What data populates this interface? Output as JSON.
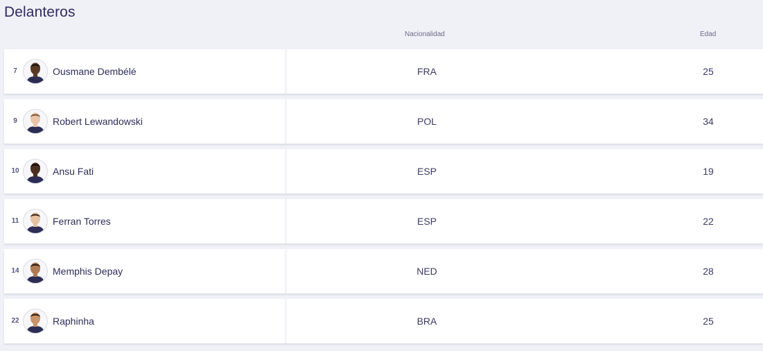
{
  "section": {
    "title": "Delanteros",
    "headers": {
      "nationality": "Nacionalidad",
      "age": "Edad"
    }
  },
  "players": [
    {
      "number": "7",
      "name": "Ousmane Dembélé",
      "nationality": "FRA",
      "age": "25",
      "skin": "#5a3a26",
      "hair": "#1b120c"
    },
    {
      "number": "9",
      "name": "Robert Lewandowski",
      "nationality": "POL",
      "age": "34",
      "skin": "#e9c4a8",
      "hair": "#7a5a3a"
    },
    {
      "number": "10",
      "name": "Ansu Fati",
      "nationality": "ESP",
      "age": "19",
      "skin": "#4a2e20",
      "hair": "#150d08"
    },
    {
      "number": "11",
      "name": "Ferran Torres",
      "nationality": "ESP",
      "age": "22",
      "skin": "#e6c0a0",
      "hair": "#3a2618"
    },
    {
      "number": "14",
      "name": "Memphis Depay",
      "nationality": "NED",
      "age": "28",
      "skin": "#b07a52",
      "hair": "#2a1c12"
    },
    {
      "number": "22",
      "name": "Raphinha",
      "nationality": "BRA",
      "age": "25",
      "skin": "#c89468",
      "hair": "#2a1a10"
    }
  ],
  "colors": {
    "background": "#f0f1f6",
    "text": "#2e2c5a",
    "shirt": "#2b2d55"
  }
}
